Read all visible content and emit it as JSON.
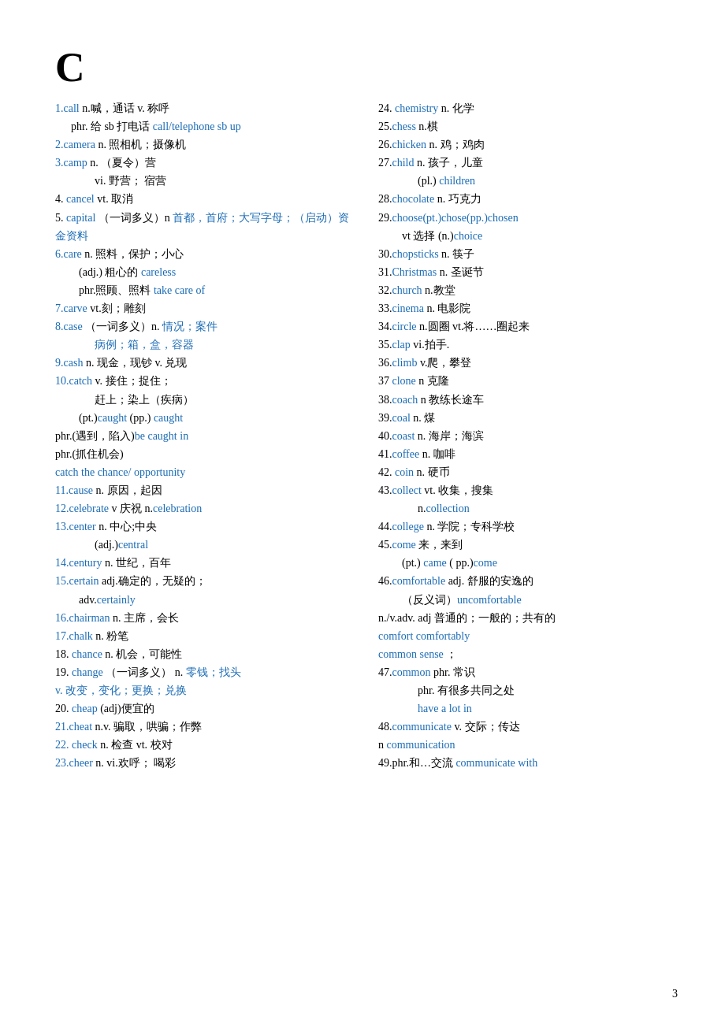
{
  "page": {
    "section_letter": "C",
    "page_number": "3"
  },
  "left_column": [
    {
      "id": "entry1",
      "content": "<span class='blue'>1.call</span>  n.喊，通话 v. 称呼"
    },
    {
      "id": "entry1a",
      "indent": 1,
      "content": "phr. 给 sb 打电话 <span class='blue'>call/telephone sb up</span>"
    },
    {
      "id": "entry2",
      "content": "<span class='blue'>2.camera</span> n. 照相机；摄像机"
    },
    {
      "id": "entry3",
      "content": "<span class='blue'>3.camp</span> n.  （夏令）营"
    },
    {
      "id": "entry3a",
      "indent": 3,
      "content": "vi. 野营；  宿营"
    },
    {
      "id": "entry4",
      "content": "4. <span class='blue'>cancel</span> vt. 取消"
    },
    {
      "id": "entry5",
      "content": "5. <span class='blue'>capital</span> （一词多义）n <span class='blue'>首都，首府；大写字母；（启动）资金资料</span>"
    },
    {
      "id": "entry6",
      "content": "<span class='blue'>6.care</span> n. 照料，保护；小心"
    },
    {
      "id": "entry6a",
      "indent": 2,
      "content": "(adj.)  粗心的 <span class='blue'>careless</span>"
    },
    {
      "id": "entry6b",
      "indent": 2,
      "content": "phr.照顾、照料 <span class='blue'>take care of</span>"
    },
    {
      "id": "entry7",
      "content": "<span class='blue'>7.carve</span>   vt.刻；雕刻"
    },
    {
      "id": "entry8",
      "content": "<span class='blue'>8.case</span> （一词多义）n. <span class='blue'>情况；案件</span>"
    },
    {
      "id": "entry8a",
      "indent": 3,
      "content": "<span class='blue'>病例；箱，盒，容器</span>"
    },
    {
      "id": "entry9",
      "content": "<span class='blue'>9.cash</span>   n. 现金，现钞 v. 兑现"
    },
    {
      "id": "entry10",
      "content": "<span class='blue'>10.catch</span>  v. 接住；捉住；"
    },
    {
      "id": "entry10a",
      "indent": 3,
      "content": "赶上；染上（疾病）"
    },
    {
      "id": "entry10b",
      "indent": 2,
      "content": "(pt.)<span class='blue'>caught</span>   (pp.) <span class='blue'>caught</span>"
    },
    {
      "id": "entry10c",
      "content": "phr.(遇到，陷入)<span class='blue'>be caught in</span>"
    },
    {
      "id": "entry10d",
      "content": "phr.(抓住机会)"
    },
    {
      "id": "entry10e",
      "content": "<span class='blue'>catch the chance/ opportunity</span>"
    },
    {
      "id": "entry11",
      "content": "<span class='blue'>11.cause</span> n. 原因，起因"
    },
    {
      "id": "entry12",
      "content": "<span class='blue'>12.celebrate</span> v 庆祝  n.<span class='blue'>celebration</span>"
    },
    {
      "id": "entry13",
      "content": "<span class='blue'>13.center</span> n. 中心;中央"
    },
    {
      "id": "entry13a",
      "indent": 3,
      "content": "(adj.)<span class='blue'>central</span>"
    },
    {
      "id": "entry14",
      "content": "<span class='blue'>14.century</span> n. 世纪，百年"
    },
    {
      "id": "entry15",
      "content": "<span class='blue'>15.certain</span> adj.确定的，无疑的；"
    },
    {
      "id": "entry15a",
      "indent": 2,
      "content": "adv.<span class='blue'>certainly</span>"
    },
    {
      "id": "entry16",
      "content": "<span class='blue'>16.chairman</span> n. 主席，会长"
    },
    {
      "id": "entry17",
      "content": "<span class='blue'>17.chalk</span> n. 粉笔"
    },
    {
      "id": "entry18",
      "content": "18. <span class='blue'>chance</span>  n. 机会，可能性"
    },
    {
      "id": "entry19",
      "content": "19. <span class='blue'>change</span> （一词多义）  n. <span class='blue'>零钱；找头</span>"
    },
    {
      "id": "entry19a",
      "content": "<span class='blue'>v. 改变，变化；更换；兑换</span>"
    },
    {
      "id": "entry20",
      "content": "20. <span class='blue'>cheap</span> (adj)便宜的"
    },
    {
      "id": "entry21",
      "content": "<span class='blue'>21.cheat</span>   n.v. 骗取，哄骗；作弊"
    },
    {
      "id": "entry22",
      "content": "<span class='blue'>22. check</span>  n. 检查 vt. 校对"
    },
    {
      "id": "entry23",
      "content": "<span class='blue'>23.cheer</span>  n. vi.欢呼；  喝彩"
    }
  ],
  "right_column": [
    {
      "id": "r24",
      "content": "24. <span class='blue'>chemistry</span>   n. 化学"
    },
    {
      "id": "r25",
      "content": "25.<span class='blue'>chess</span> n.棋"
    },
    {
      "id": "r26",
      "content": "26.<span class='blue'>chicken</span> n. 鸡；鸡肉"
    },
    {
      "id": "r27",
      "content": "27.<span class='blue'>child</span> n. 孩子，儿童"
    },
    {
      "id": "r27a",
      "indent": 3,
      "content": "(pl.) <span class='blue'>children</span>"
    },
    {
      "id": "r28",
      "content": "28.<span class='blue'>chocolate</span> n. 巧克力"
    },
    {
      "id": "r29",
      "content": "29.<span class='blue'>choose(pt.)chose(pp.)chosen</span>"
    },
    {
      "id": "r29a",
      "indent": 2,
      "content": "vt 选择  (n.)<span class='blue'>choice</span>"
    },
    {
      "id": "r30",
      "content": "30.<span class='blue'>chopsticks</span>  n. 筷子"
    },
    {
      "id": "r31",
      "content": "31.<span class='blue'>Christmas</span>  n. 圣诞节"
    },
    {
      "id": "r32",
      "content": "32.<span class='blue'>church</span> n.教堂"
    },
    {
      "id": "r33",
      "content": "33.<span class='blue'>cinema</span> n. 电影院"
    },
    {
      "id": "r34",
      "content": "34.<span class='blue'>circle</span> n.圆圈 vt.将……圈起来"
    },
    {
      "id": "r35",
      "content": "35.<span class='blue'>clap</span> vi.拍手."
    },
    {
      "id": "r36",
      "content": "36.<span class='blue'>climb</span> v.爬，攀登"
    },
    {
      "id": "r37",
      "content": "37 <span class='blue'>clone</span> n 克隆"
    },
    {
      "id": "r38",
      "content": "38.<span class='blue'>coach</span> n 教练长途车"
    },
    {
      "id": "r39",
      "content": "39.<span class='blue'>coal</span> n. 煤"
    },
    {
      "id": "r40",
      "content": "40.<span class='blue'>coast</span> n. 海岸；海滨"
    },
    {
      "id": "r41",
      "content": "41.<span class='blue'>coffee</span> n. 咖啡"
    },
    {
      "id": "r42",
      "content": "42. <span class='blue'>coin</span> n.  硬币"
    },
    {
      "id": "r43",
      "content": "43.<span class='blue'>collect</span> vt. 收集，搜集"
    },
    {
      "id": "r43a",
      "indent": 3,
      "content": "n.<span class='blue'>collection</span>"
    },
    {
      "id": "r44",
      "content": "44.<span class='blue'>college</span> n. 学院；专科学校"
    },
    {
      "id": "r45",
      "content": "45.<span class='blue'>come</span> 来，来到"
    },
    {
      "id": "r45a",
      "indent": 2,
      "content": "(pt.) <span class='blue'>came</span>      ( pp.)<span class='blue'>come</span>"
    },
    {
      "id": "r46",
      "content": "46.<span class='blue'>comfortable</span> adj.  舒服的安逸的"
    },
    {
      "id": "r46a",
      "indent": 2,
      "content": "（反义词）<span class='blue'>uncomfortable</span>"
    },
    {
      "id": "r46b",
      "content": "n./v.adv.  adj 普通的；一般的；共有的"
    },
    {
      "id": "r46c",
      "content": "<span class='blue'>comfort comfortably</span>"
    },
    {
      "id": "r46d",
      "content": "<span class='blue'>common sense</span> ；"
    },
    {
      "id": "r47",
      "content": "47.<span class='blue'>common</span> phr. 常识"
    },
    {
      "id": "r47a",
      "indent": 3,
      "content": "phr. 有很多共同之处"
    },
    {
      "id": "r47b",
      "indent": 3,
      "content": "<span class='blue'>have a lot in</span>"
    },
    {
      "id": "r48",
      "content": "48.<span class='blue'>communicate</span> v. 交际；传达"
    },
    {
      "id": "r48a",
      "content": "  n <span class='blue'>communication</span>"
    },
    {
      "id": "r49",
      "content": "49.phr.和…交流 <span class='blue'>communicate with</span>"
    }
  ]
}
